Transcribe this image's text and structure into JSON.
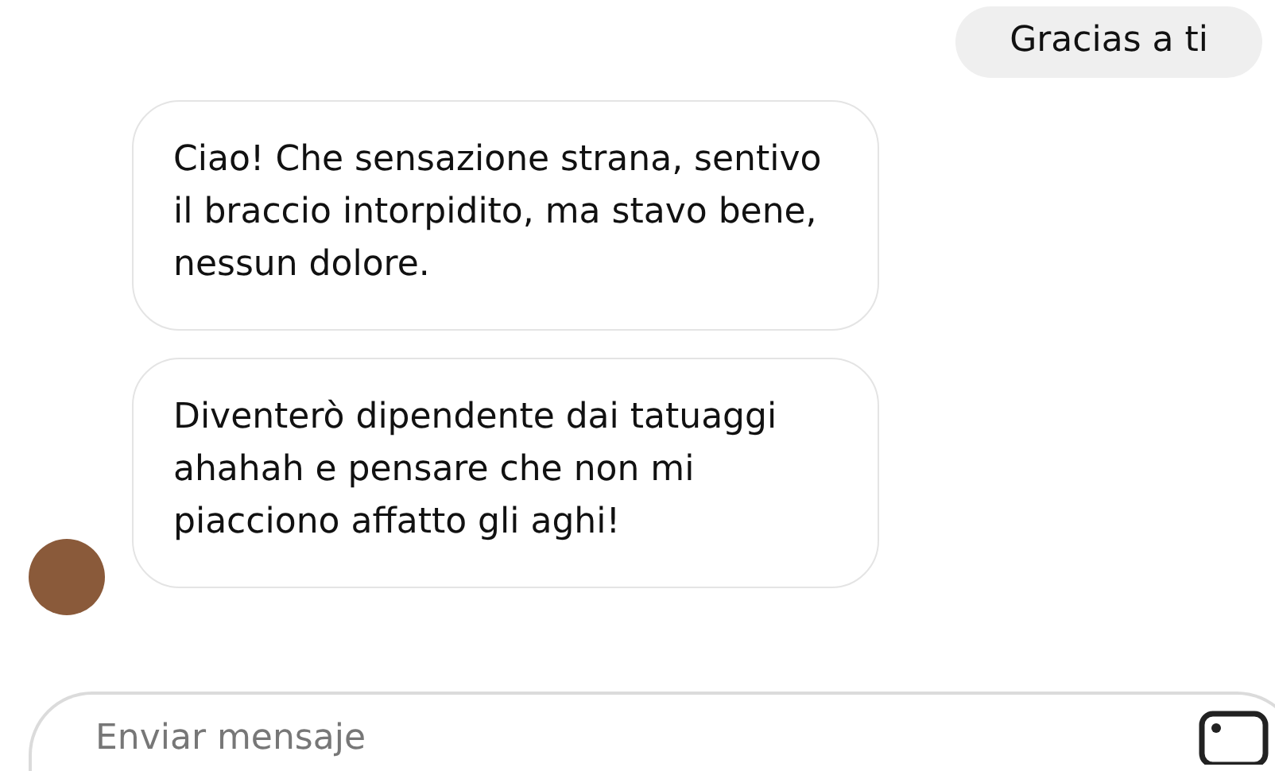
{
  "messages": [
    {
      "kind": "sent",
      "text": "Gracias a ti"
    },
    {
      "kind": "received",
      "text": "Ciao! Che sensazione strana, sentivo il braccio intorpidito, ma stavo bene, nessun dolore.",
      "avatar": false
    },
    {
      "kind": "received",
      "text": "Diventerò dipendente dai tatuaggi ahahah e pensare che non mi piacciono affatto gli aghi!",
      "avatar": true
    }
  ],
  "composer": {
    "placeholder": "Enviar mensaje"
  }
}
